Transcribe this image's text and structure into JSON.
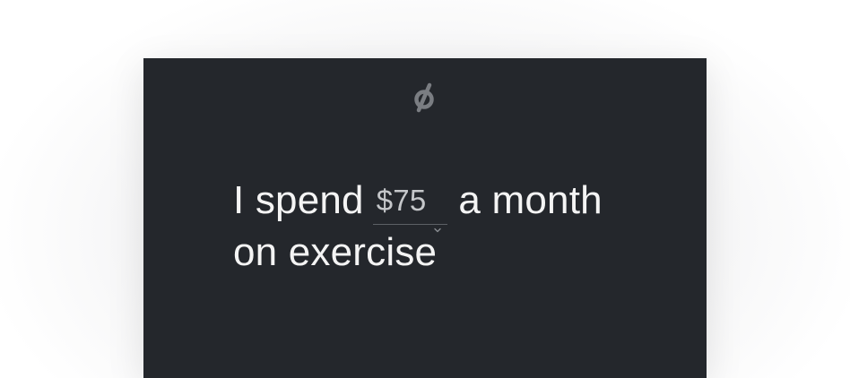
{
  "logo": {
    "icon": "peloton-logo-icon"
  },
  "sentence": {
    "prefix": "I spend",
    "amount_select": {
      "selected": "$75",
      "icon": "chevron-down-icon"
    },
    "suffix": "a month",
    "line2": "on exercise"
  },
  "colors": {
    "card_background": "#24272c",
    "text": "#f4f4f4",
    "select_text": "#c5c7ca",
    "logo": "#7a7d82"
  }
}
